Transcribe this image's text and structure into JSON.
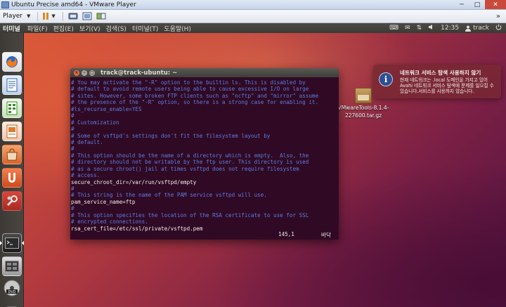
{
  "vmware": {
    "window_title": "Ubuntu Precise amd64 - VMware Player",
    "minimize": "─",
    "maximize": "□",
    "close": "✕",
    "player_menu": "Player",
    "player_arrow": "▼",
    "right_arrows": "»"
  },
  "panel": {
    "app_name": "터미널",
    "menus": [
      "파일(F)",
      "편집(E)",
      "보기(V)",
      "검색(S)",
      "터미널(T)",
      "도움말(H)"
    ],
    "keyboard": "⌨",
    "mail": "✉",
    "network": "⇅",
    "volume": "🔊",
    "time": "12:35",
    "user_icon": "👤",
    "user": "track",
    "power": "⏻"
  },
  "terminal": {
    "title": "track@track-ubuntu: ~",
    "close_glyph": "×",
    "min_glyph": "–",
    "max_glyph": "□",
    "lines": [
      {
        "kind": "comment",
        "text": "# You may activate the \"-R\" option to the builtin ls. This is disabled by"
      },
      {
        "kind": "comment",
        "text": "# default to avoid remote users being able to cause excessive I/O on large"
      },
      {
        "kind": "comment",
        "text": "# sites. However, some broken FTP clients such as \"ncftp\" and \"mirror\" assume"
      },
      {
        "kind": "comment",
        "text": "# the presence of the \"-R\" option, so there is a strong case for enabling it."
      },
      {
        "kind": "comment",
        "text": "#ls_recurse_enable=YES"
      },
      {
        "kind": "comment",
        "text": "#"
      },
      {
        "kind": "comment",
        "text": "# Customization"
      },
      {
        "kind": "comment",
        "text": "#"
      },
      {
        "kind": "comment",
        "text": "# Some of vsftpd's settings don't fit the filesystem layout by"
      },
      {
        "kind": "comment",
        "text": "# default."
      },
      {
        "kind": "comment",
        "text": "#"
      },
      {
        "kind": "comment",
        "text": "# This option should be the name of a directory which is empty.  Also, the"
      },
      {
        "kind": "comment",
        "text": "# directory should not be writable by the ftp user. This directory is used"
      },
      {
        "kind": "comment",
        "text": "# as a secure chroot() jail at times vsftpd does not require filesystem"
      },
      {
        "kind": "comment",
        "text": "# access."
      },
      {
        "kind": "directive",
        "text": "secure_chroot_dir=/var/run/vsftpd/empty"
      },
      {
        "kind": "comment",
        "text": "#"
      },
      {
        "kind": "comment",
        "text": "# This string is the name of the PAM service vsftpd will use."
      },
      {
        "kind": "highlight",
        "text": "pam_service_name=ftp"
      },
      {
        "kind": "comment",
        "text": "#"
      },
      {
        "kind": "comment",
        "text": "# This option specifies the location of the RSA certificate to use for SSL"
      },
      {
        "kind": "comment",
        "text": "# encrypted connections."
      },
      {
        "kind": "directive",
        "text": "rsa_cert_file=/etc/ssl/private/vsftpd.pem"
      }
    ],
    "status_position": "145,1",
    "status_mode": "바닥"
  },
  "desktop_file": {
    "badge": "tar.gz",
    "label_line1": "VMwareTools-8.1.4-",
    "label_line2": "227600.tar.gz"
  },
  "notification": {
    "icon_glyph": "i",
    "title": "네트워크 서비스 탐색 사용하지 않기",
    "body": "현재 네트워크는 .local 도메인을 가지고 있어 Avahi 네트워크 서비스 탐색에 문제를 일으킬 수 있습니다.서비스를 사용하지 않습니다."
  },
  "colors": {
    "terminal_bg": "#300a24",
    "comment": "#5f7ae0",
    "directive": "#f0eeea",
    "underline": "#e02020",
    "launcher_bg": "#3d3a36",
    "notification_bg": "#782832"
  }
}
